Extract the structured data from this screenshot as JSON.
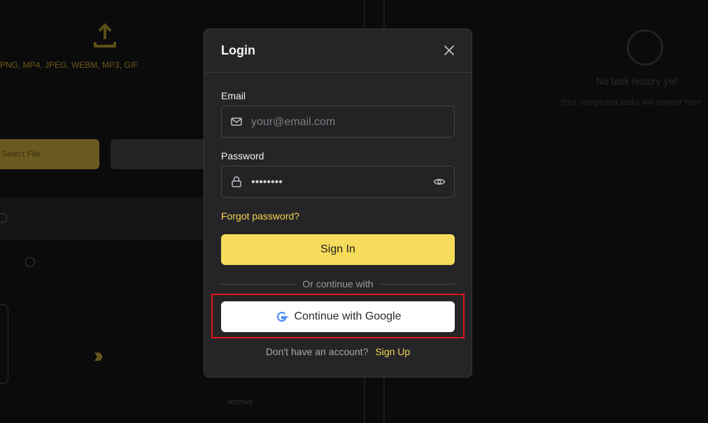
{
  "background": {
    "hint_text": "PNG, MP4, JPEG, WEBM, MP3, GIF",
    "yellow_button_label": "Select File",
    "history_title": "No task history yet",
    "history_sub": "Your completed tasks will appear here",
    "bottom_label": "Archive"
  },
  "modal": {
    "title": "Login",
    "email_label": "Email",
    "email_placeholder": "your@email.com",
    "password_label": "Password",
    "password_value": "••••••••",
    "forgot_label": "Forgot password?",
    "signin_label": "Sign In",
    "divider_text": "Or continue with",
    "google_label": "Continue with Google",
    "signup_question": "Don't have an account?",
    "signup_link": "Sign Up"
  },
  "colors": {
    "accent": "#f7dc5b",
    "link": "#f5d454",
    "modal_bg": "#252527",
    "highlight": "#e0161a"
  },
  "icons": [
    "close-icon",
    "mail-icon",
    "lock-icon",
    "eye-icon",
    "google-icon",
    "upload-icon",
    "history-icon"
  ]
}
